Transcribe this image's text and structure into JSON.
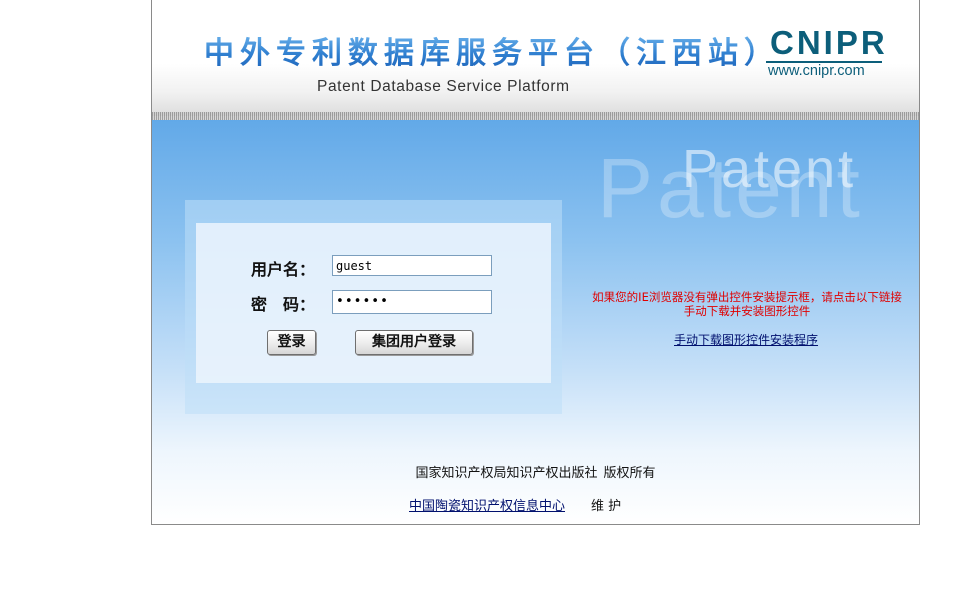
{
  "header": {
    "title_cn": "中外专利数据库服务平台（江西站）",
    "title_en": "Patent Database Service Platform",
    "logo_text": "CNIPR",
    "logo_url": "www.cnipr.com"
  },
  "watermark": "Patent",
  "login": {
    "username_label": "用户名：",
    "username_value": "guest",
    "password_label": "密　码：",
    "password_value": "••••••",
    "login_button": "登录",
    "group_login_button": "集团用户登录"
  },
  "notice": {
    "text": "如果您的IE浏览器没有弹出控件安装提示框，请点击以下链接手动下载并安装图形控件",
    "download_link": "手动下载图形控件安装程序"
  },
  "footer": {
    "copyright_org": "国家知识产权局知识产权出版社",
    "copyright_rights": "版权所有",
    "maintainer_link": "中国陶瓷知识产权信息中心",
    "maintainer_suffix": "维 护"
  },
  "colors": {
    "title_blue": "#2f7fd0",
    "logo_teal": "#0c5e7a",
    "notice_red": "#e00000",
    "link_navy": "#00106e"
  }
}
